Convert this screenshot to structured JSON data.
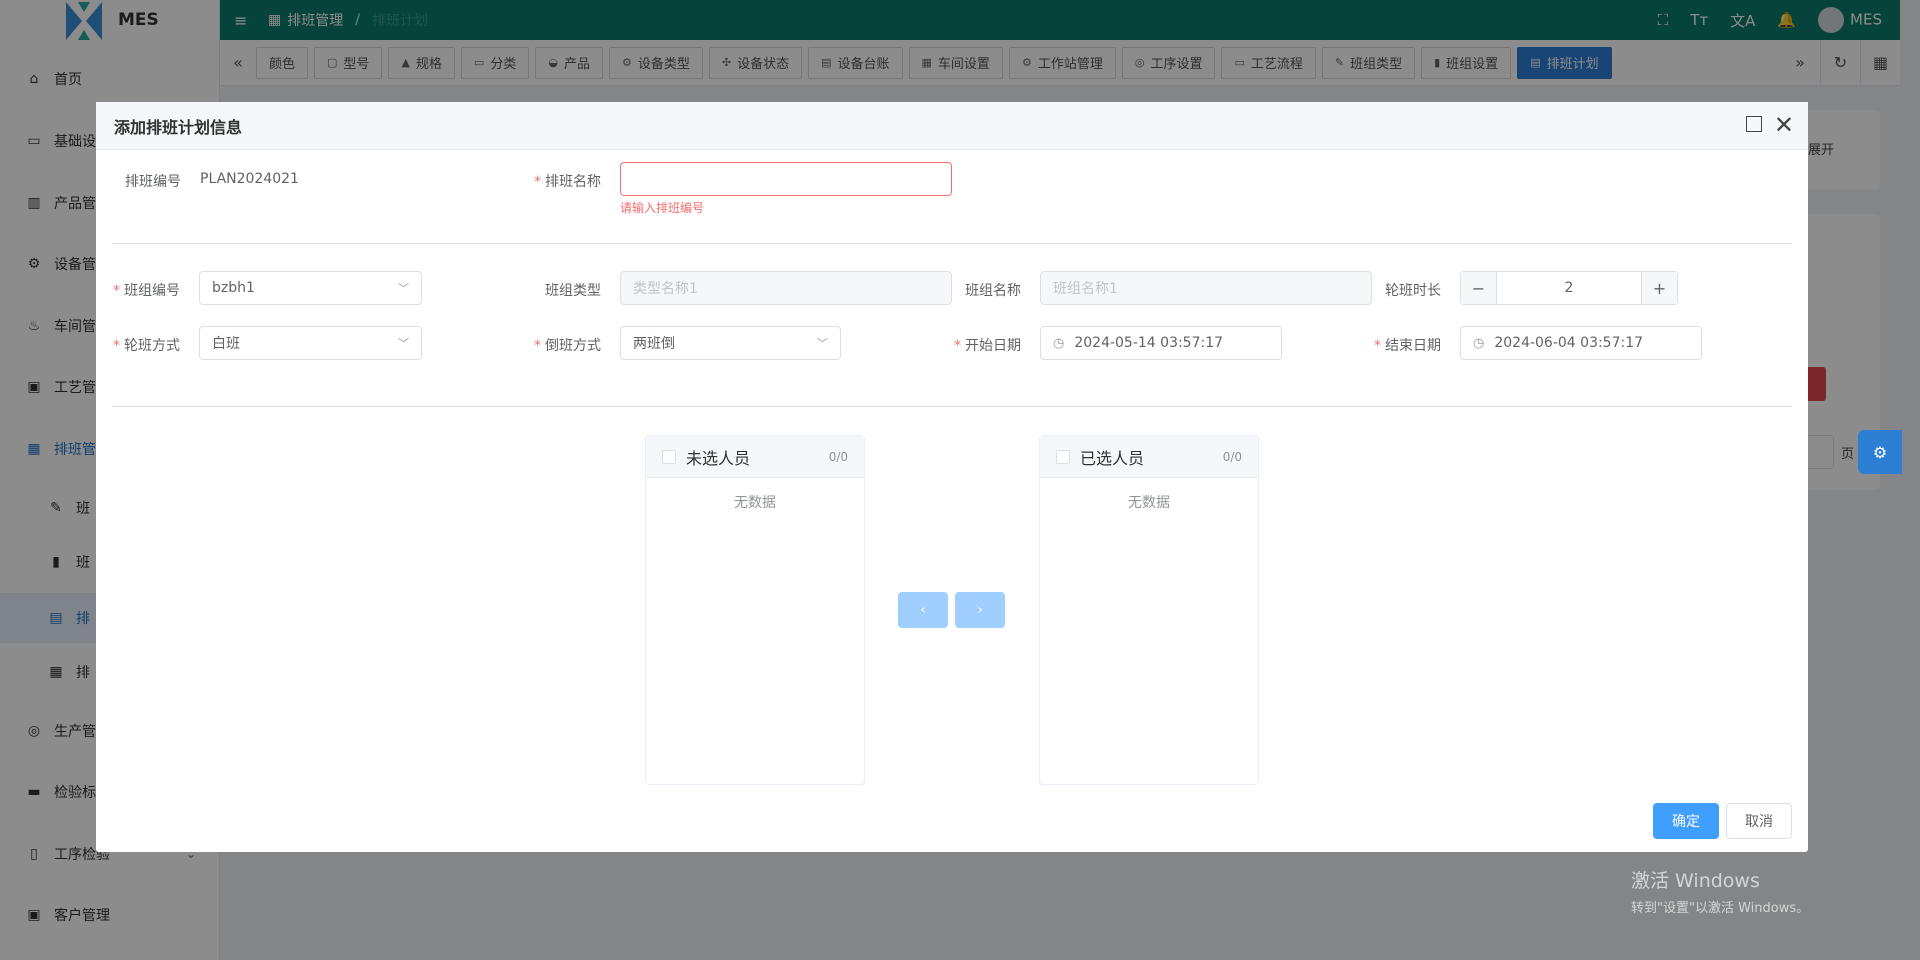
{
  "app": {
    "name": "MES",
    "user": "MES"
  },
  "sidebar": {
    "items": [
      {
        "label": "首页",
        "icon": "home-icon"
      },
      {
        "label": "基础设",
        "icon": "monitor-icon"
      },
      {
        "label": "产品管",
        "icon": "bar-chart-icon"
      },
      {
        "label": "设备管",
        "icon": "chip-icon"
      },
      {
        "label": "车间管",
        "icon": "pot-icon"
      },
      {
        "label": "工艺管",
        "icon": "briefcase-icon"
      },
      {
        "label": "排班管",
        "icon": "calendar-icon"
      },
      {
        "label": "班",
        "icon": "pencil-icon"
      },
      {
        "label": "班",
        "icon": "book-icon"
      },
      {
        "label": "排",
        "icon": "message-icon"
      },
      {
        "label": "排",
        "icon": "calendar-grid-icon"
      },
      {
        "label": "生产管",
        "icon": "database-icon"
      },
      {
        "label": "检验标",
        "icon": "monitor-icon"
      },
      {
        "label": "工序检验",
        "icon": "book-open-icon"
      },
      {
        "label": "客户管理",
        "icon": "user-card-icon"
      }
    ]
  },
  "header": {
    "breadcrumb": [
      "排班管理",
      "排班计划"
    ]
  },
  "tabs": [
    "颜色",
    "型号",
    "规格",
    "分类",
    "产品",
    "设备类型",
    "设备状态",
    "设备台账",
    "车间设置",
    "工作站管理",
    "工序设置",
    "工艺流程",
    "班组类型",
    "班组设置",
    "排班计划"
  ],
  "background": {
    "expand_label": "展开",
    "page_label": "页"
  },
  "dialog": {
    "title": "添加排班计划信息",
    "plan_code_label": "排班编号",
    "plan_code_value": "PLAN2024021",
    "plan_name_label": "排班名称",
    "plan_name_value": "",
    "plan_name_error": "请输入排班编号",
    "team_code_label": "班组编号",
    "team_code_value": "bzbh1",
    "team_type_label": "班组类型",
    "team_type_placeholder": "类型名称1",
    "team_name_label": "班组名称",
    "team_name_placeholder": "班组名称1",
    "shift_duration_label": "轮班时长",
    "shift_duration_value": "2",
    "rotation_label": "轮班方式",
    "rotation_value": "白班",
    "switch_label": "倒班方式",
    "switch_value": "两班倒",
    "start_label": "开始日期",
    "start_value": "2024-05-14 03:57:17",
    "end_label": "结束日期",
    "end_value": "2024-06-04 03:57:17",
    "transfer": {
      "left_title": "未选人员",
      "left_count": "0/0",
      "right_title": "已选人员",
      "right_count": "0/0",
      "empty_text": "无数据"
    },
    "ok_label": "确定",
    "cancel_label": "取消"
  },
  "watermark": {
    "line1": "激活 Windows",
    "line2": "转到\"设置\"以激活 Windows。"
  }
}
